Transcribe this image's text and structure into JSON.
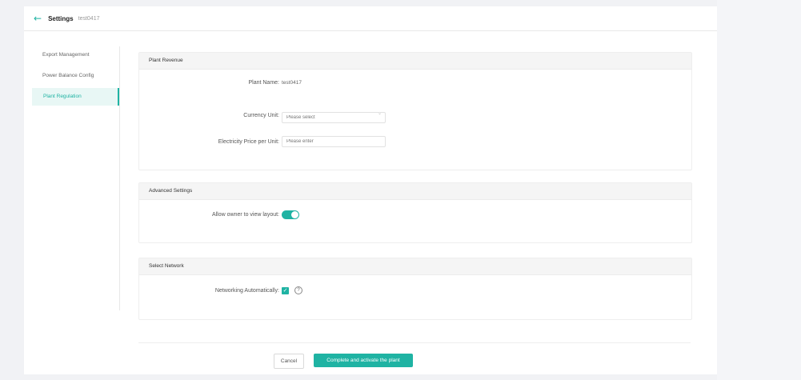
{
  "header": {
    "back_icon": "arrow-left-icon",
    "title": "Settings",
    "plant_name": "test0417"
  },
  "sidebar": {
    "items": [
      {
        "label": "Export Management",
        "active": false
      },
      {
        "label": "Power Balance Config",
        "active": false
      },
      {
        "label": "Plant Regulation",
        "active": true
      }
    ]
  },
  "plant_revenue": {
    "heading": "Plant Revenue",
    "plant_name_label": "Plant Name:",
    "plant_name_value": "test0417",
    "currency_label": "Currency Unit:",
    "currency_placeholder": "Please select",
    "price_label": "Electricity Price per Unit:",
    "price_placeholder": "Please enter"
  },
  "advanced": {
    "heading": "Advanced Settings",
    "layout_label": "Allow owner to view layout:",
    "layout_enabled": true
  },
  "network": {
    "heading": "Select Network",
    "auto_label": "Networking Automatically:",
    "auto_checked": true,
    "help_icon": "question-circle-icon"
  },
  "footer": {
    "cancel_label": "Cancel",
    "submit_label": "Complete and activate the plant"
  },
  "colors": {
    "accent": "#1fb3a3"
  }
}
